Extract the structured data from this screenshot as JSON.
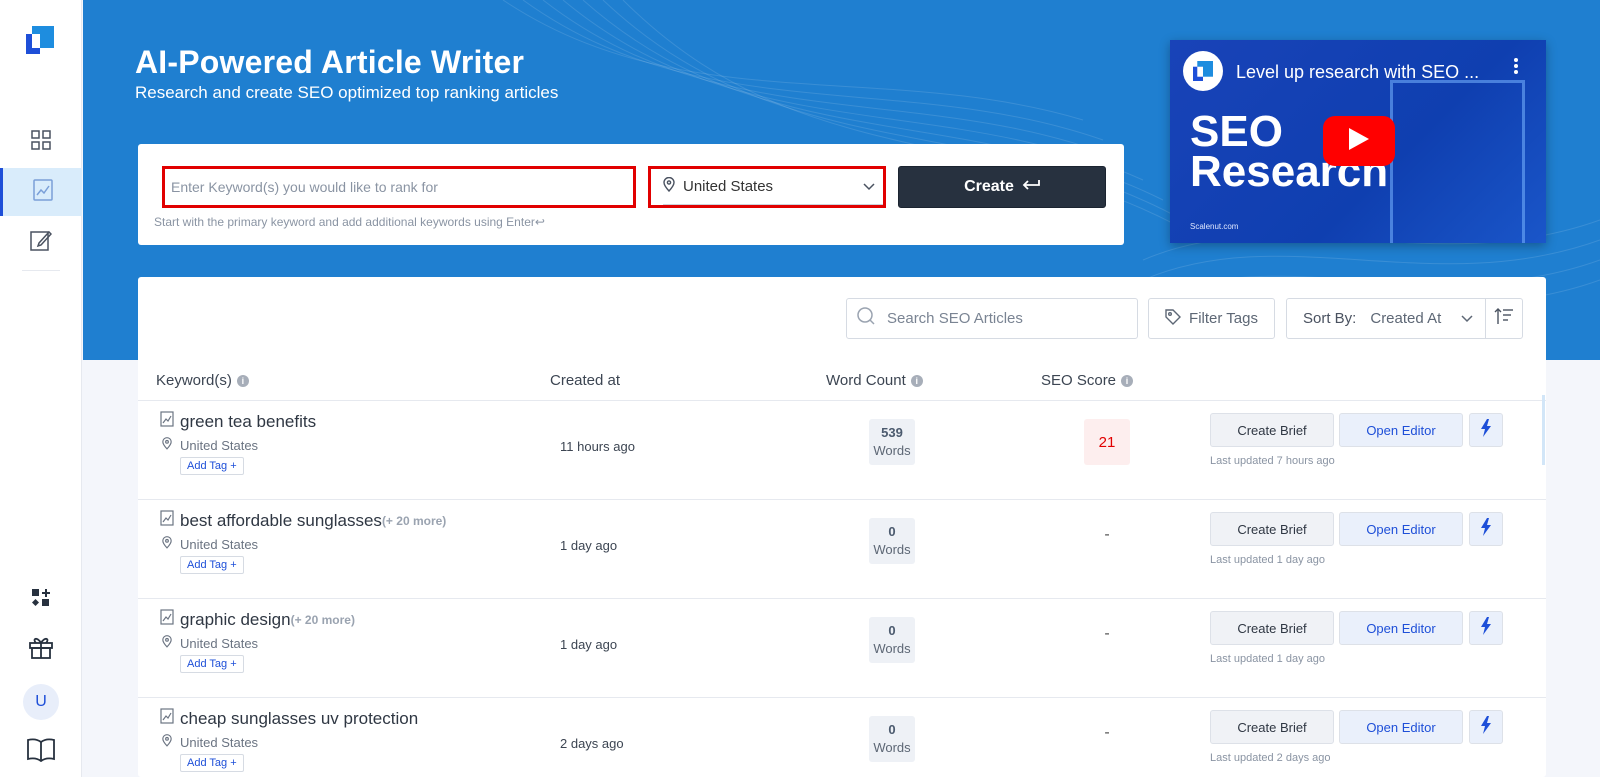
{
  "app": {
    "title": "AI-Powered Article Writer",
    "subtitle": "Research and create SEO optimized top ranking articles"
  },
  "sidebar": {
    "items": [
      {
        "name": "dashboard",
        "icon": "grid-icon"
      },
      {
        "name": "seo-articles",
        "icon": "chart-document-icon",
        "active": true
      },
      {
        "name": "editor",
        "icon": "edit-icon"
      }
    ],
    "bottom": [
      {
        "name": "integrations",
        "icon": "apps-add-icon"
      },
      {
        "name": "gift",
        "icon": "gift-icon"
      },
      {
        "name": "account",
        "avatar_letter": "U"
      },
      {
        "name": "docs",
        "icon": "book-icon"
      }
    ]
  },
  "create_form": {
    "keyword_placeholder": "Enter Keyword(s) you would like to rank for",
    "keyword_value": "",
    "location": "United States",
    "create_label": "Create",
    "hint": "Start with the primary keyword and add additional keywords using Enter↩"
  },
  "video": {
    "title": "Level up research with SEO ...",
    "headline_line1": "SEO",
    "headline_line2": "Research",
    "footer": "Scalenut.com"
  },
  "toolbar": {
    "search_placeholder": "Search SEO Articles",
    "filter_label": "Filter Tags",
    "sort_label": "Sort By:",
    "sort_value": "Created At"
  },
  "table": {
    "headers": {
      "keyword": "Keyword(s)",
      "created": "Created at",
      "word_count": "Word Count",
      "seo_score": "SEO Score"
    },
    "rows": [
      {
        "keyword": "green tea benefits",
        "more": "",
        "location": "United States",
        "tag": "Add Tag +",
        "created": "11 hours ago",
        "words": "539",
        "words_label": "Words",
        "score": "21",
        "brief": "Create Brief",
        "editor": "Open Editor",
        "updated": "Last updated 7 hours ago"
      },
      {
        "keyword": "best affordable sunglasses",
        "more": "(+ 20 more)",
        "location": "United States",
        "tag": "Add Tag +",
        "created": "1 day ago",
        "words": "0",
        "words_label": "Words",
        "score": "-",
        "brief": "Create Brief",
        "editor": "Open Editor",
        "updated": "Last updated 1 day ago"
      },
      {
        "keyword": "graphic design",
        "more": "(+ 20 more)",
        "location": "United States",
        "tag": "Add Tag +",
        "created": "1 day ago",
        "words": "0",
        "words_label": "Words",
        "score": "-",
        "brief": "Create Brief",
        "editor": "Open Editor",
        "updated": "Last updated 1 day ago"
      },
      {
        "keyword": "cheap sunglasses uv protection",
        "more": "",
        "location": "United States",
        "tag": "Add Tag +",
        "created": "2 days ago",
        "words": "0",
        "words_label": "Words",
        "score": "-",
        "brief": "Create Brief",
        "editor": "Open Editor",
        "updated": "Last updated 2 days ago"
      }
    ]
  },
  "colors": {
    "hero": "#1f7fd0",
    "accent": "#1e4fd8",
    "highlight_border": "#e10000",
    "create_button": "#27313f"
  }
}
